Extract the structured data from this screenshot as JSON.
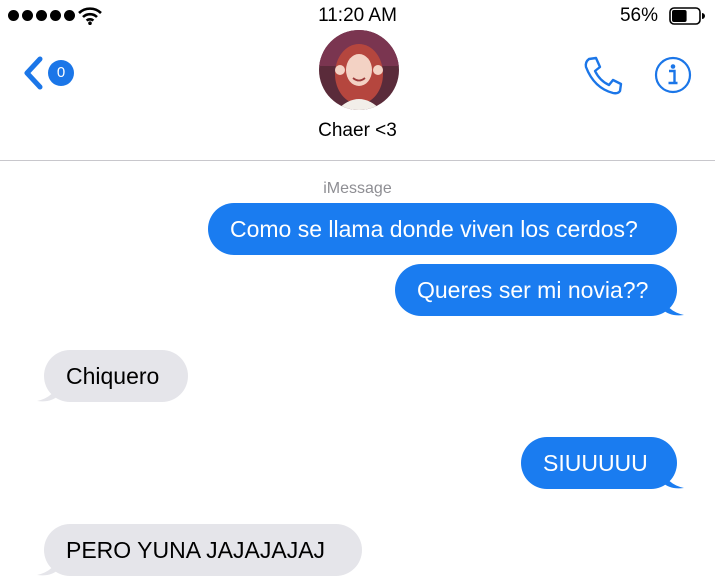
{
  "status_bar": {
    "time": "11:20 AM",
    "battery_percent": "56%",
    "battery_level": 0.56,
    "signal_bars": 5,
    "icons": [
      "signal-dots-icon",
      "wifi-icon",
      "battery-icon"
    ]
  },
  "header": {
    "back_badge": "0",
    "contact_name": "Chaer <3",
    "icons": [
      "back-chevron-icon",
      "phone-icon",
      "info-icon"
    ]
  },
  "conversation": {
    "service_label": "iMessage",
    "messages": [
      {
        "direction": "sent",
        "text": "Como se llama donde viven los cerdos?"
      },
      {
        "direction": "sent",
        "text": "Queres ser mi novia??"
      },
      {
        "direction": "received",
        "text": "Chiquero"
      },
      {
        "direction": "sent",
        "text": "SIUUUUU"
      },
      {
        "direction": "received",
        "text": "PERO YUNA JAJAJAJAJ"
      }
    ]
  },
  "colors": {
    "accent": "#1b76e8",
    "sent_bubble": "#1a7cf0",
    "received_bubble": "#e5e5ea",
    "divider": "#c8c7cc",
    "secondary_text": "#8e8e93"
  }
}
